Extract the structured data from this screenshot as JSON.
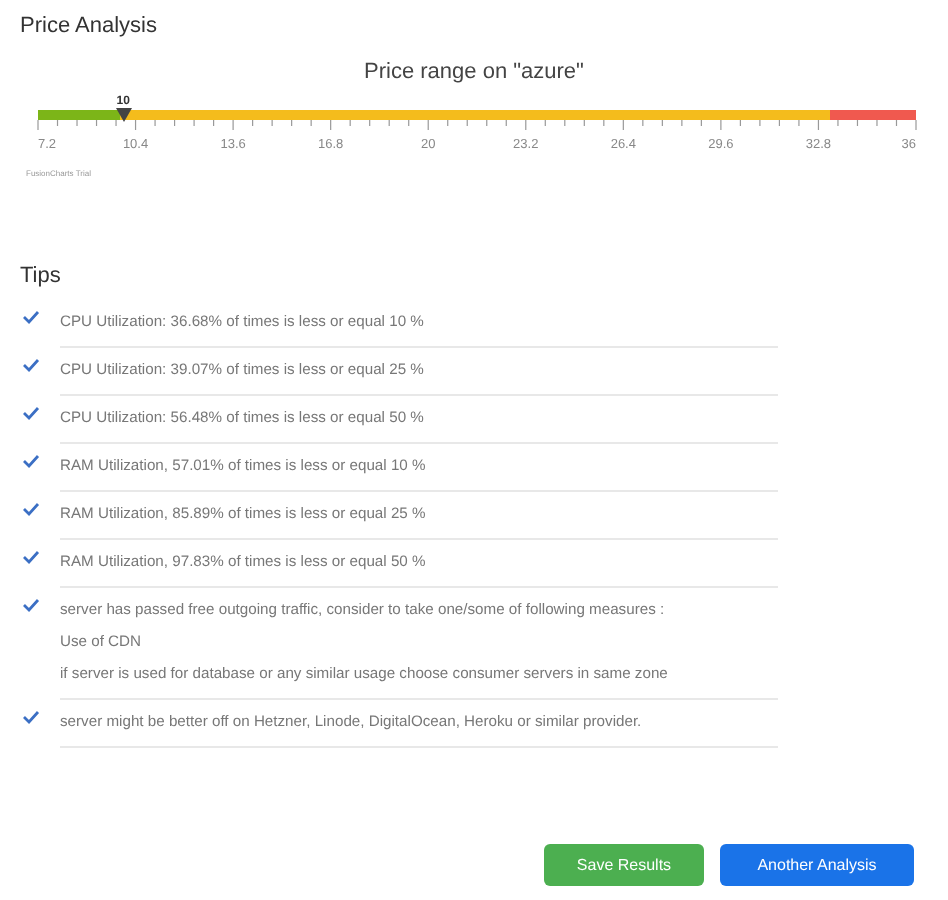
{
  "page_title": "Price Analysis",
  "gauge": {
    "title": "Price range on \"azure\"",
    "pointer_label": "10",
    "level": 0.097,
    "ranges": [
      {
        "color": "#7cb518",
        "level": 0.093
      },
      {
        "color": "#f4bc1c",
        "level": 0.902
      },
      {
        "color": "#f0594f"
      }
    ],
    "ticks": [
      "7.2",
      "10.4",
      "13.6",
      "16.8",
      "20",
      "23.2",
      "26.4",
      "29.6",
      "32.8",
      "36"
    ],
    "credit": "FusionCharts Trial"
  },
  "tips_title": "Tips",
  "tips": [
    {
      "lines": [
        "CPU Utilization: 36.68% of times is less or equal 10 %"
      ]
    },
    {
      "lines": [
        "CPU Utilization: 39.07% of times is less or equal 25 %"
      ]
    },
    {
      "lines": [
        "CPU Utilization: 56.48% of times is less or equal 50 %"
      ]
    },
    {
      "lines": [
        "RAM Utilization, 57.01% of times is less or equal 10 %"
      ]
    },
    {
      "lines": [
        "RAM Utilization, 85.89% of times is less or equal 25 %"
      ]
    },
    {
      "lines": [
        "RAM Utilization, 97.83% of times is less or equal 50 %"
      ]
    },
    {
      "lines": [
        "server has passed free outgoing traffic, consider to take one/some of following measures :",
        "Use of CDN",
        "if server is used for database or any similar usage choose consumer servers in same zone"
      ]
    },
    {
      "lines": [
        "server might be better off on Hetzner, Linode, DigitalOcean, Heroku or similar provider."
      ]
    }
  ],
  "buttons": [
    {
      "label": "Save Results",
      "kind": "secondary"
    },
    {
      "label": "Another Analysis",
      "kind": "primary"
    }
  ]
}
